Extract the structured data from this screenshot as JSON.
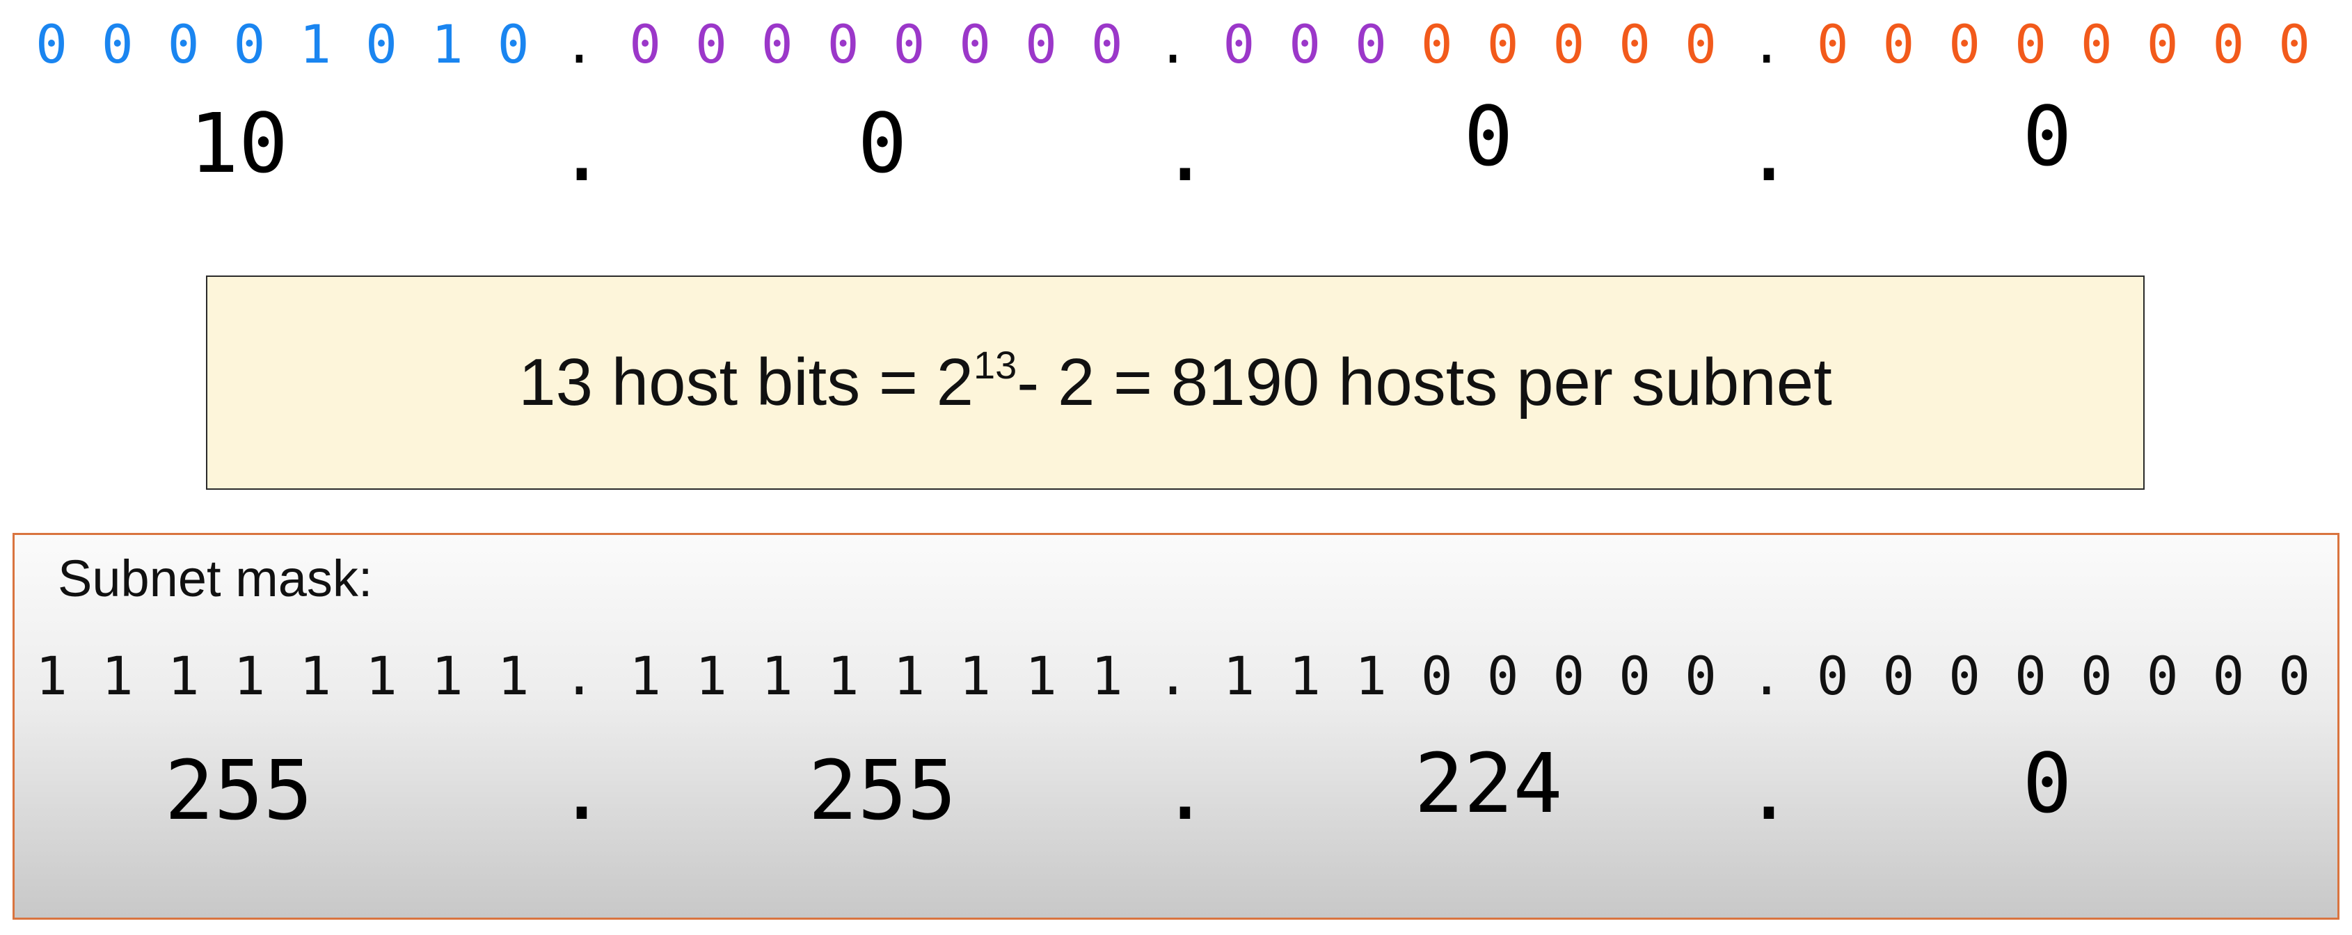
{
  "colors": {
    "network_blue": "#1a85f0",
    "subnet_purple": "#9b37c9",
    "host_orange": "#f25a1b",
    "mask_text": "#111111",
    "formula_bg": "#fdf5da",
    "panel_border": "#d9743f"
  },
  "ip": {
    "bits": [
      {
        "t": "0",
        "c": "blue"
      },
      {
        "t": "0",
        "c": "blue"
      },
      {
        "t": "0",
        "c": "blue"
      },
      {
        "t": "0",
        "c": "blue"
      },
      {
        "t": "1",
        "c": "blue"
      },
      {
        "t": "0",
        "c": "blue"
      },
      {
        "t": "1",
        "c": "blue"
      },
      {
        "t": "0",
        "c": "blue"
      },
      {
        "t": ".",
        "c": "black"
      },
      {
        "t": "0",
        "c": "purple"
      },
      {
        "t": "0",
        "c": "purple"
      },
      {
        "t": "0",
        "c": "purple"
      },
      {
        "t": "0",
        "c": "purple"
      },
      {
        "t": "0",
        "c": "purple"
      },
      {
        "t": "0",
        "c": "purple"
      },
      {
        "t": "0",
        "c": "purple"
      },
      {
        "t": "0",
        "c": "purple"
      },
      {
        "t": ".",
        "c": "black"
      },
      {
        "t": "0",
        "c": "purple"
      },
      {
        "t": "0",
        "c": "purple"
      },
      {
        "t": "0",
        "c": "purple"
      },
      {
        "t": "0",
        "c": "orange"
      },
      {
        "t": "0",
        "c": "orange"
      },
      {
        "t": "0",
        "c": "orange"
      },
      {
        "t": "0",
        "c": "orange"
      },
      {
        "t": "0",
        "c": "orange"
      },
      {
        "t": ".",
        "c": "black"
      },
      {
        "t": "0",
        "c": "orange"
      },
      {
        "t": "0",
        "c": "orange"
      },
      {
        "t": "0",
        "c": "orange"
      },
      {
        "t": "0",
        "c": "orange"
      },
      {
        "t": "0",
        "c": "orange"
      },
      {
        "t": "0",
        "c": "orange"
      },
      {
        "t": "0",
        "c": "orange"
      },
      {
        "t": "0",
        "c": "orange"
      }
    ],
    "decimal": {
      "octet1": "10",
      "dot1": ".",
      "octet2": "0",
      "dot2": ".",
      "octet3": "0",
      "dot3": ".",
      "octet4": "0"
    }
  },
  "formula": {
    "prefix": "13 host bits = 2",
    "exponent": "13",
    "suffix": "- 2 = 8190 hosts per subnet"
  },
  "mask": {
    "label": "Subnet mask:",
    "bits": [
      "1",
      "1",
      "1",
      "1",
      "1",
      "1",
      "1",
      "1",
      ".",
      "1",
      "1",
      "1",
      "1",
      "1",
      "1",
      "1",
      "1",
      ".",
      "1",
      "1",
      "1",
      "0",
      "0",
      "0",
      "0",
      "0",
      ".",
      "0",
      "0",
      "0",
      "0",
      "0",
      "0",
      "0",
      "0"
    ],
    "decimal": {
      "octet1": "255",
      "dot1": ".",
      "octet2": "255",
      "dot2": ".",
      "octet3": "224",
      "dot3": ".",
      "octet4": "0"
    }
  }
}
